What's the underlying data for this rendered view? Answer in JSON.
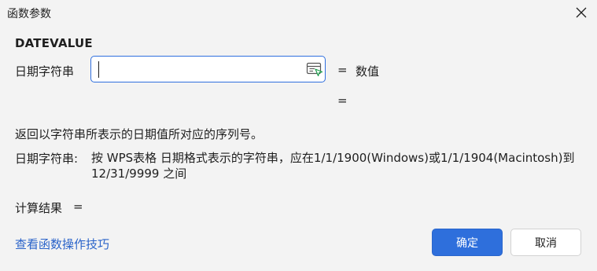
{
  "window": {
    "title": "函数参数"
  },
  "function": {
    "name": "DATEVALUE"
  },
  "arguments": [
    {
      "label": "日期字符串",
      "value": "",
      "equals": "=",
      "result": "数值"
    }
  ],
  "extra_equals": "=",
  "description": "返回以字符串所表示的日期值所对应的序列号。",
  "param_help": {
    "label": "日期字符串:",
    "text": "按 WPS表格 日期格式表示的字符串，应在1/1/1900(Windows)或1/1/1904(Macintosh)到 12/31/9999 之间"
  },
  "result": {
    "label": "计算结果",
    "equals": "="
  },
  "footer": {
    "help_link": "查看函数操作技巧",
    "ok_label": "确定",
    "cancel_label": "取消"
  },
  "colors": {
    "accent": "#2e6fdc",
    "link": "#2a63c9",
    "background": "#f3f3f3"
  },
  "icons": {
    "close": "close-icon",
    "range_select": "range-select-icon"
  }
}
